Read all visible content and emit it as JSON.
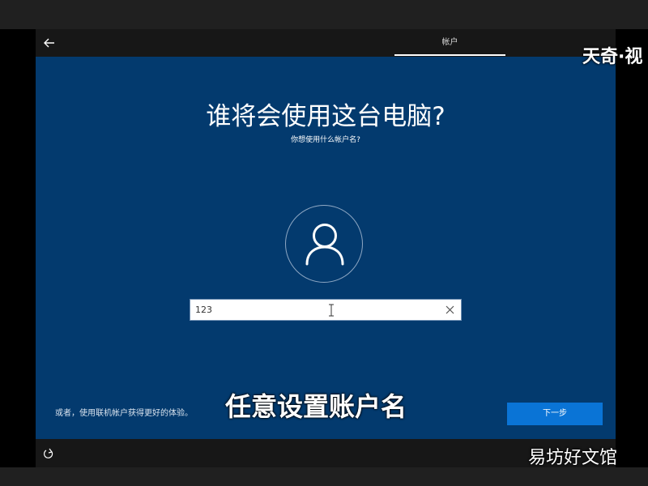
{
  "topbar": {
    "tab_label": "帐户"
  },
  "setup": {
    "title": "谁将会使用这台电脑?",
    "subtitle": "你想使用什么帐户名?",
    "username": {
      "value": "123",
      "placeholder": ""
    },
    "hint": "或者，使用联机帐户获得更好的体验。",
    "next_label": "下一步"
  },
  "overlay": {
    "caption": "任意设置账户名",
    "watermark_top": "天奇·视",
    "watermark_bottom": "易坊好文馆"
  },
  "colors": {
    "background": "#033a6e",
    "bar": "#171717",
    "accent": "#0a74d6"
  },
  "icons": {
    "back": "back-arrow-icon",
    "avatar": "user-icon",
    "clear": "close-icon",
    "accessibility": "accessibility-icon"
  }
}
